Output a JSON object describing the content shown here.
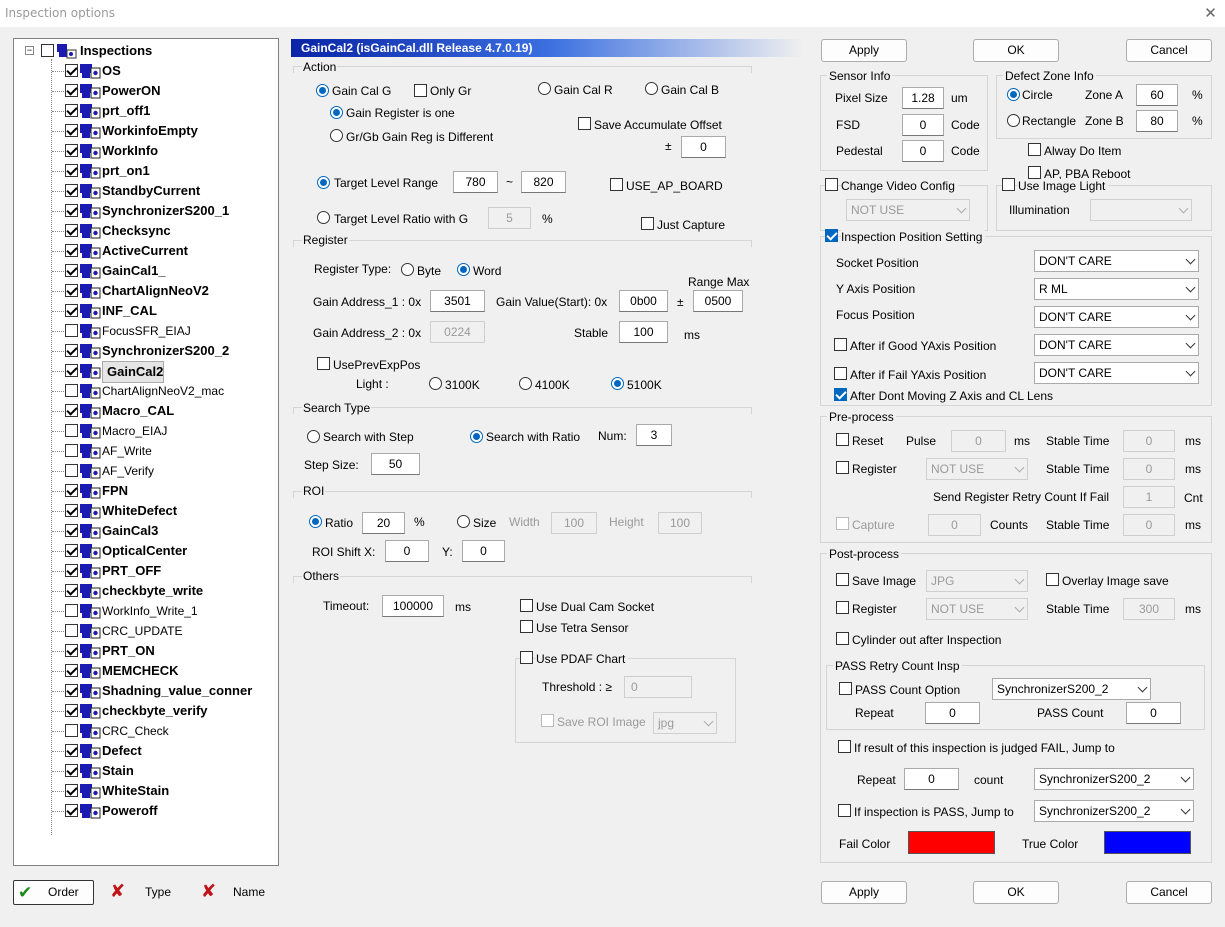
{
  "window": {
    "title": "Inspection options",
    "close_icon": "close-icon"
  },
  "tree": {
    "root": "Inspections",
    "items": [
      {
        "label": "OS",
        "checked": true,
        "bold": true
      },
      {
        "label": "PowerON",
        "checked": true,
        "bold": true
      },
      {
        "label": "prt_off1",
        "checked": true,
        "bold": true
      },
      {
        "label": "WorkinfoEmpty",
        "checked": true,
        "bold": true
      },
      {
        "label": "WorkInfo",
        "checked": true,
        "bold": true
      },
      {
        "label": "prt_on1",
        "checked": true,
        "bold": true
      },
      {
        "label": "StandbyCurrent",
        "checked": true,
        "bold": true
      },
      {
        "label": "SynchronizerS200_1",
        "checked": true,
        "bold": true
      },
      {
        "label": "Checksync",
        "checked": true,
        "bold": true
      },
      {
        "label": "ActiveCurrent",
        "checked": true,
        "bold": true
      },
      {
        "label": "GainCal1_",
        "checked": true,
        "bold": true
      },
      {
        "label": "ChartAlignNeoV2",
        "checked": true,
        "bold": true
      },
      {
        "label": "INF_CAL",
        "checked": true,
        "bold": true
      },
      {
        "label": "FocusSFR_EIAJ",
        "checked": false,
        "bold": false
      },
      {
        "label": "SynchronizerS200_2",
        "checked": true,
        "bold": true
      },
      {
        "label": "GainCal2",
        "checked": true,
        "bold": true,
        "selected": true
      },
      {
        "label": "ChartAlignNeoV2_mac",
        "checked": false,
        "bold": false
      },
      {
        "label": "Macro_CAL",
        "checked": true,
        "bold": true
      },
      {
        "label": "Macro_EIAJ",
        "checked": false,
        "bold": false
      },
      {
        "label": "AF_Write",
        "checked": false,
        "bold": false
      },
      {
        "label": "AF_Verify",
        "checked": false,
        "bold": false
      },
      {
        "label": "FPN",
        "checked": true,
        "bold": true
      },
      {
        "label": "WhiteDefect",
        "checked": true,
        "bold": true
      },
      {
        "label": "GainCal3",
        "checked": true,
        "bold": true
      },
      {
        "label": "OpticalCenter",
        "checked": true,
        "bold": true
      },
      {
        "label": "PRT_OFF",
        "checked": true,
        "bold": true
      },
      {
        "label": "checkbyte_write",
        "checked": true,
        "bold": true
      },
      {
        "label": "WorkInfo_Write_1",
        "checked": false,
        "bold": false
      },
      {
        "label": "CRC_UPDATE",
        "checked": false,
        "bold": false
      },
      {
        "label": "PRT_ON",
        "checked": true,
        "bold": true
      },
      {
        "label": "MEMCHECK",
        "checked": true,
        "bold": true
      },
      {
        "label": "Shadning_value_conner",
        "checked": true,
        "bold": true
      },
      {
        "label": "checkbyte_verify",
        "checked": true,
        "bold": true
      },
      {
        "label": "CRC_Check",
        "checked": false,
        "bold": false
      },
      {
        "label": "Defect",
        "checked": true,
        "bold": true
      },
      {
        "label": "Stain",
        "checked": true,
        "bold": true
      },
      {
        "label": "WhiteStain",
        "checked": true,
        "bold": true
      },
      {
        "label": "Poweroff",
        "checked": true,
        "bold": true
      }
    ]
  },
  "bottom_left": {
    "order": "Order",
    "type": "Type",
    "name": "Name"
  },
  "header": "GainCal2  (isGainCal.dll   Release 4.7.0.19)",
  "action": {
    "title": "Action",
    "gain_cal_g": "Gain Cal G",
    "only_gr": "Only Gr",
    "gain_cal_r": "Gain Cal R",
    "gain_cal_b": "Gain Cal B",
    "gain_reg_one": "Gain Register is one",
    "grgb_diff": "Gr/Gb Gain Reg is Different",
    "save_acc": "Save Accumulate Offset",
    "pm": "±",
    "offset": "0",
    "target_range": "Target Level Range",
    "range_min": "780",
    "tilde": "~",
    "range_max": "820",
    "use_ap_board": "USE_AP_BOARD",
    "target_ratio": "Target Level Ratio with G",
    "ratio_val": "5",
    "pct": "%",
    "just_capture": "Just Capture"
  },
  "register": {
    "title": "Register",
    "reg_type": "Register Type:",
    "byte": "Byte",
    "word": "Word",
    "range_max_lbl": "Range Max",
    "addr1_lbl": "Gain Address_1 : 0x",
    "addr1": "3501",
    "gain_val_lbl": "Gain Value(Start): 0x",
    "gain_val": "0b00",
    "pm": "±",
    "range_max": "0500",
    "addr2_lbl": "Gain Address_2 : 0x",
    "addr2": "0224",
    "stable_lbl": "Stable",
    "stable": "100",
    "ms": "ms",
    "use_prev": "UsePrevExpPos",
    "light": "Light :",
    "l3100": "3100K",
    "l4100": "4100K",
    "l5100": "5100K"
  },
  "search": {
    "title": "Search Type",
    "with_step": "Search with Step",
    "with_ratio": "Search with Ratio",
    "num_lbl": "Num:",
    "num": "3",
    "step_lbl": "Step Size:",
    "step": "50"
  },
  "roi": {
    "title": "ROI",
    "ratio": "Ratio",
    "ratio_val": "20",
    "pct": "%",
    "size": "Size",
    "width_lbl": "Width",
    "width": "100",
    "height_lbl": "Height",
    "height": "100",
    "shift_lbl": "ROI Shift X:",
    "shift_x": "0",
    "y_lbl": "Y:",
    "shift_y": "0"
  },
  "others": {
    "title": "Others",
    "timeout_lbl": "Timeout:",
    "timeout": "100000",
    "ms": "ms",
    "dual_cam": "Use Dual Cam Socket",
    "tetra": "Use Tetra Sensor",
    "pdaf": "Use PDAF Chart",
    "threshold_lbl": "Threshold : ≥",
    "threshold": "0",
    "save_roi": "Save ROI Image",
    "img_fmt": "jpg"
  },
  "buttons": {
    "apply": "Apply",
    "ok": "OK",
    "cancel": "Cancel"
  },
  "sensor": {
    "title": "Sensor Info",
    "pixel_lbl": "Pixel Size",
    "pixel": "1.28",
    "um": "um",
    "fsd_lbl": "FSD",
    "fsd": "0",
    "ped_lbl": "Pedestal",
    "ped": "0",
    "code": "Code"
  },
  "defect_zone": {
    "title": "Defect Zone Info",
    "circle": "Circle",
    "rect": "Rectangle",
    "zone_a_lbl": "Zone A",
    "zone_a": "60",
    "zone_b_lbl": "Zone B",
    "zone_b": "80",
    "pct": "%",
    "alway": "Alway Do Item",
    "ap_reboot": "AP, PBA Reboot"
  },
  "video": {
    "change": "Change Video Config",
    "not_use": "NOT USE",
    "image_light": "Use Image Light",
    "illum": "Illumination"
  },
  "position": {
    "setting": "Inspection Position Setting",
    "socket_lbl": "Socket Position",
    "socket": "DON'T CARE",
    "yaxis_lbl": "Y Axis Position",
    "yaxis": "R ML",
    "focus_lbl": "Focus Position",
    "focus": "DON'T CARE",
    "after_good": "After if Good YAxis Position",
    "after_good_val": "DON'T CARE",
    "after_fail": "After if Fail YAxis Position",
    "after_fail_val": "DON'T CARE",
    "dont_moving": "After Dont Moving Z Axis and CL Lens"
  },
  "pre": {
    "title": "Pre-process",
    "reset": "Reset",
    "pulse_lbl": "Pulse",
    "pulse": "0",
    "ms": "ms",
    "stable_lbl": "Stable Time",
    "stable1": "0",
    "register": "Register",
    "reg_sel": "NOT USE",
    "stable2": "0",
    "retry_lbl": "Send Register Retry Count If Fail",
    "retry": "1",
    "cnt": "Cnt",
    "capture": "Capture",
    "counts_val": "0",
    "counts": "Counts",
    "stable3": "0"
  },
  "post": {
    "title": "Post-process",
    "save_image": "Save Image",
    "img_fmt": "JPG",
    "overlay": "Overlay Image save",
    "register": "Register",
    "reg_sel": "NOT USE",
    "stable_lbl": "Stable Time",
    "stable": "300",
    "ms": "ms",
    "cylinder": "Cylinder out after Inspection",
    "pass_retry": "PASS Retry Count Insp",
    "pass_opt": "PASS Count Option",
    "pass_sel": "SynchronizerS200_2",
    "repeat_lbl": "Repeat",
    "repeat": "0",
    "pass_count_lbl": "PASS Count",
    "pass_count": "0",
    "fail_jump": "If result of this inspection is judged FAIL, Jump to",
    "repeat2_lbl": "Repeat",
    "repeat2": "0",
    "count": "count",
    "fail_sel": "SynchronizerS200_2",
    "pass_jump": "If inspection is PASS, Jump to",
    "pass_jump_sel": "SynchronizerS200_2",
    "fail_color_lbl": "Fail Color",
    "fail_color": "#ff0000",
    "true_color_lbl": "True Color",
    "true_color": "#0000ff"
  }
}
